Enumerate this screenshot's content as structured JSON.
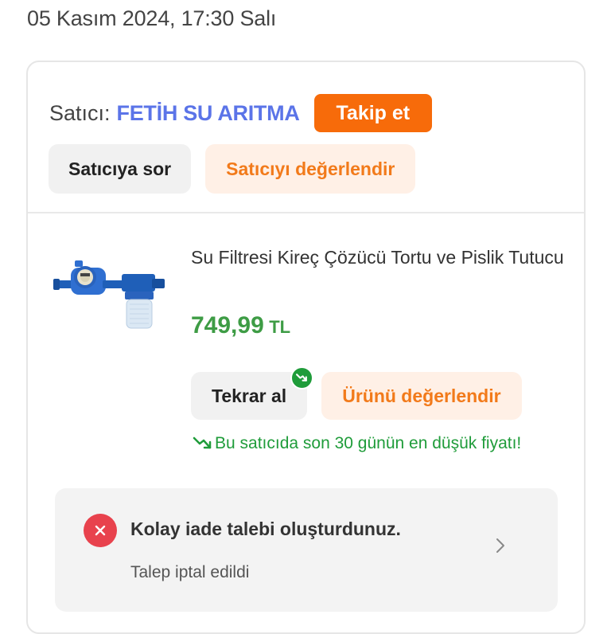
{
  "order": {
    "date": "05 Kasım 2024, 17:30 Salı"
  },
  "seller": {
    "label": "Satıcı:",
    "name": "FETİH SU ARITMA",
    "follow_label": "Takip et",
    "ask_label": "Satıcıya sor",
    "rate_label": "Satıcıyı değerlendir"
  },
  "product": {
    "title": "Su Filtresi Kireç Çözücü Tortu ve Pislik Tutucu",
    "price_amount": "749,99",
    "price_currency": "TL",
    "rebuy_label": "Tekrar al",
    "rate_label": "Ürünü değerlendir",
    "lowest_price_note": "Bu satıcıda son 30 günün en düşük fiyatı!"
  },
  "return_request": {
    "title": "Kolay iade talebi oluşturdunuz.",
    "status": "Talep iptal edildi",
    "status_icon": "close-circle-icon"
  },
  "colors": {
    "brand_orange": "#f27a1a",
    "follow_button": "#f76b0a",
    "seller_name": "#5b74e8",
    "price_green": "#3e9c45",
    "note_green": "#1f9c3a",
    "error_red": "#e8424d"
  },
  "icons": {
    "price_trend": "trend-down-icon",
    "navigate": "chevron-right-icon"
  }
}
